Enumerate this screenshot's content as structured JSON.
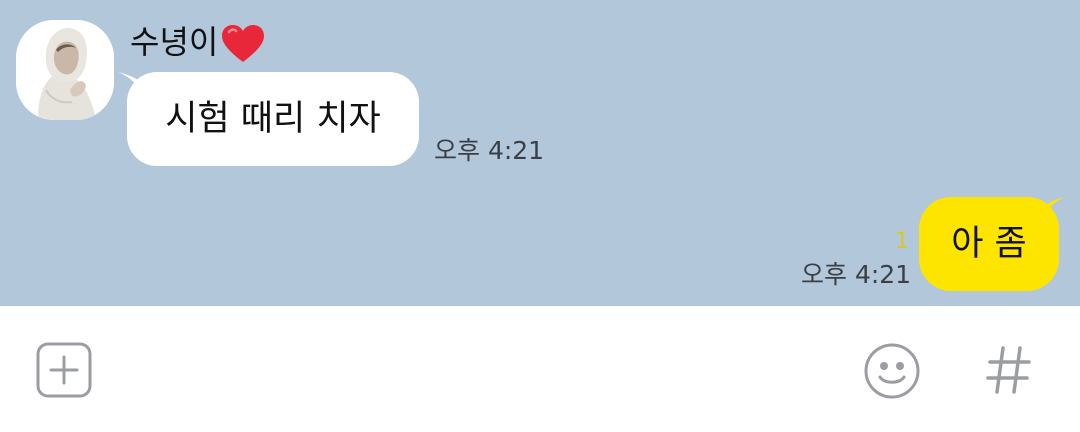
{
  "chat": {
    "background_color": "#b2c7da",
    "incoming": {
      "sender_name": "수녕이",
      "sender_emoji": "heart-emoji",
      "message": "시험 때리 치자",
      "time": "오후 4:21",
      "bubble_color": "#ffffff"
    },
    "outgoing": {
      "message": "아 좀",
      "unread_count": "1",
      "time": "오후 4:21",
      "bubble_color": "#fee500"
    }
  },
  "input_bar": {
    "plus_icon": "plus-square-icon",
    "emoji_icon": "smiley-icon",
    "hash_icon": "hashtag-icon"
  }
}
